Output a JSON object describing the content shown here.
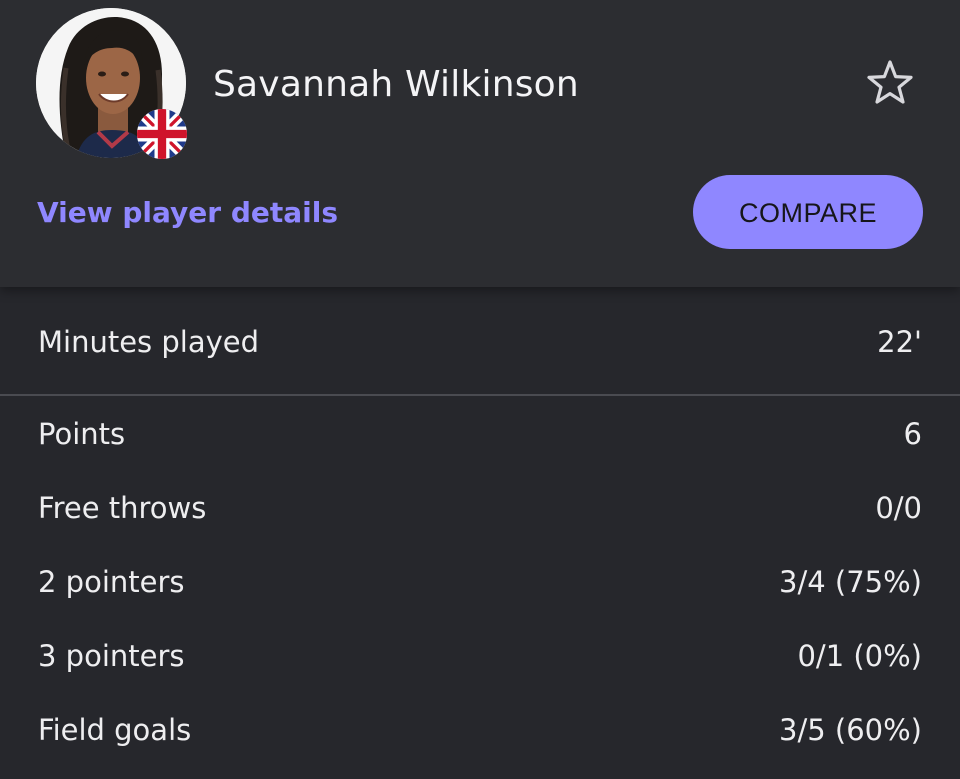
{
  "player": {
    "name": "Savannah Wilkinson",
    "nationality_flag": "uk-flag-icon",
    "avatar": "player-photo",
    "favorite_icon": "star-outline-icon"
  },
  "actions": {
    "details_link": "View player details",
    "compare_button": "COMPARE"
  },
  "colors": {
    "accent": "#8f87ff",
    "background": "#26272c",
    "header_background": "#2c2d31",
    "text": "#eeeef0"
  },
  "summary": {
    "label": "Minutes played",
    "value": "22'"
  },
  "stats": [
    {
      "label": "Points",
      "value": "6"
    },
    {
      "label": "Free throws",
      "value": "0/0"
    },
    {
      "label": "2 pointers",
      "value": "3/4 (75%)"
    },
    {
      "label": "3 pointers",
      "value": "0/1 (0%)"
    },
    {
      "label": "Field goals",
      "value": "3/5 (60%)"
    }
  ]
}
